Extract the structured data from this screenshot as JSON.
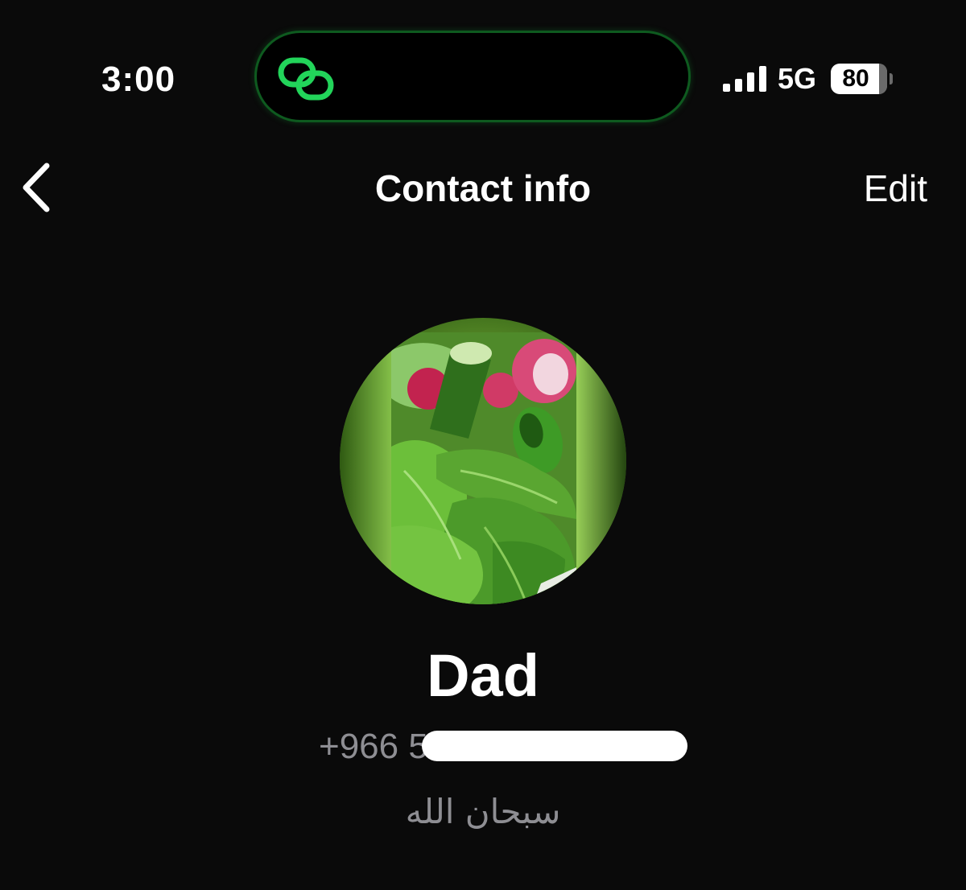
{
  "status_bar": {
    "time": "3:00",
    "network": "5G",
    "battery": "80",
    "icons": [
      "link-icon",
      "signal-icon",
      "battery-icon"
    ],
    "accent_color": "#22d45a"
  },
  "nav": {
    "back_icon": "chevron-left-icon",
    "title": "Contact info",
    "edit_label": "Edit"
  },
  "contact": {
    "avatar_icon": "vegetables-photo",
    "name": "Dad",
    "phone_prefix": "+966 5",
    "status": "سبحان الله"
  }
}
